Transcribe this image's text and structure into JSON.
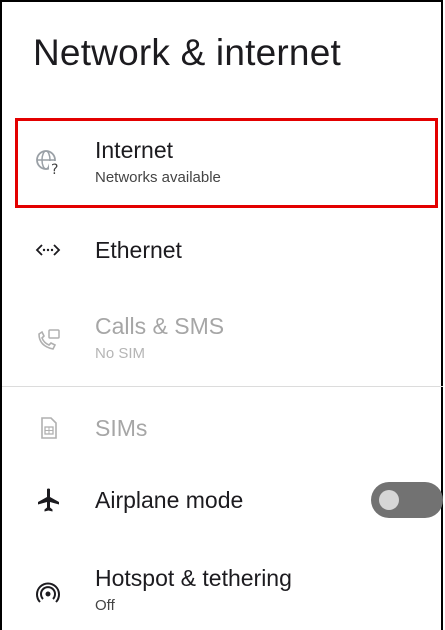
{
  "header": {
    "title": "Network & internet"
  },
  "items": [
    {
      "title": "Internet",
      "subtitle": "Networks available",
      "icon": "wifi-question-icon",
      "enabled": true,
      "highlighted": true
    },
    {
      "title": "Ethernet",
      "icon": "ethernet-icon",
      "enabled": true
    },
    {
      "title": "Calls & SMS",
      "subtitle": "No SIM",
      "icon": "calls-sms-icon",
      "enabled": false
    },
    {
      "title": "SIMs",
      "icon": "sim-card-icon",
      "enabled": false
    },
    {
      "title": "Airplane mode",
      "icon": "airplane-icon",
      "enabled": true,
      "toggle": "off"
    },
    {
      "title": "Hotspot & tethering",
      "subtitle": "Off",
      "icon": "hotspot-icon",
      "enabled": true
    }
  ],
  "colors": {
    "highlight": "#e30000",
    "disabled_text": "#a6a6a6",
    "toggle_track": "#727272"
  }
}
